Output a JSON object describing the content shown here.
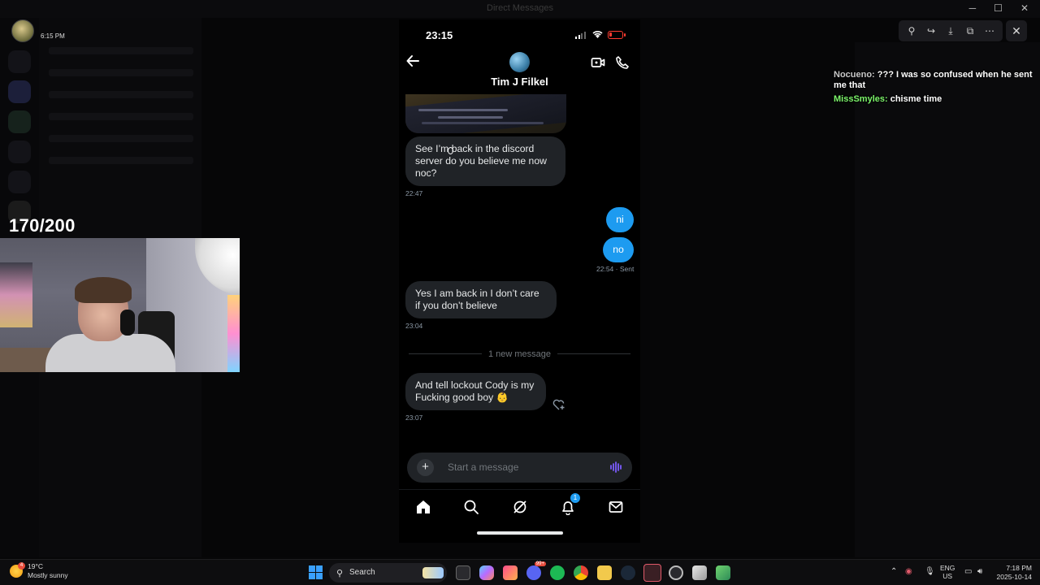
{
  "window": {
    "title": "Direct Messages"
  },
  "streamer": {
    "time": "6:15 PM"
  },
  "counter": {
    "text": "170/200"
  },
  "phone": {
    "status": {
      "time": "23:15",
      "battery_fraction": 0.2
    },
    "header": {
      "name": "Tim J Filkel"
    },
    "messages": {
      "m1": {
        "text": "See I’m back in the discord server do you believe me now noc?",
        "time": "22:47"
      },
      "m2": {
        "text": "ni"
      },
      "m3": {
        "text": "no",
        "time": "22:54 · Sent"
      },
      "m4": {
        "text": "Yes I am back in I don’t care if you don’t believe",
        "time": "23:04"
      },
      "divider": "1 new message",
      "m5": {
        "text": "And tell lockout Cody is my Fucking good boy 👶",
        "time": "23:07"
      }
    },
    "compose": {
      "placeholder": "Start a message"
    },
    "tabs": {
      "notification_count": "1"
    }
  },
  "stream_chat": [
    {
      "user": "Nocueno:",
      "message": "??? I was so confused when he sent me that",
      "user_color": "#c8c8c8"
    },
    {
      "user": "MissSmyles:",
      "message": "chisme time",
      "user_color": "#7cf56a"
    }
  ],
  "taskbar": {
    "weather_temp": "19°C",
    "weather_desc": "Mostly sunny",
    "weather_badge": "4",
    "search_label": "Search",
    "lang_top": "ENG",
    "lang_bottom": "US",
    "time": "7:18 PM",
    "date": "2025-10-14",
    "discord_badge": "99+"
  },
  "icons": {
    "start": "windows-start-icon",
    "search": "search-icon",
    "back": "back-arrow-icon",
    "video": "video-call-icon",
    "phone": "phone-call-icon"
  },
  "colors": {
    "accent": "#1d9bf0",
    "bubble_in": "#202327",
    "battery": "#ff3b30"
  }
}
